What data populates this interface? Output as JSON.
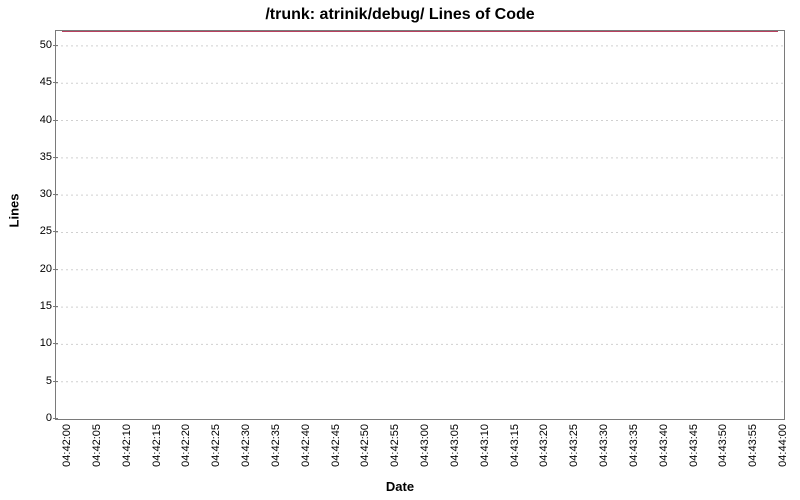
{
  "chart_data": {
    "type": "line",
    "title": "/trunk: atrinik/debug/ Lines of Code",
    "xlabel": "Date",
    "ylabel": "Lines",
    "ylim": [
      0,
      52
    ],
    "y_ticks": [
      0,
      5,
      10,
      15,
      20,
      25,
      30,
      35,
      40,
      45,
      50
    ],
    "x_ticks": [
      "04:42:00",
      "04:42:05",
      "04:42:10",
      "04:42:15",
      "04:42:20",
      "04:42:25",
      "04:42:30",
      "04:42:35",
      "04:42:40",
      "04:42:45",
      "04:42:50",
      "04:42:55",
      "04:43:00",
      "04:43:05",
      "04:43:10",
      "04:43:15",
      "04:43:20",
      "04:43:25",
      "04:43:30",
      "04:43:35",
      "04:43:40",
      "04:43:45",
      "04:43:50",
      "04:43:55",
      "04:44:00"
    ],
    "series": [
      {
        "name": "Lines of Code",
        "color": "#a0002a",
        "x": [
          "04:42:00",
          "04:42:05",
          "04:42:10",
          "04:42:15",
          "04:42:20",
          "04:42:25",
          "04:42:30",
          "04:42:35",
          "04:42:40",
          "04:42:45",
          "04:42:50",
          "04:42:55",
          "04:43:00",
          "04:43:05",
          "04:43:10",
          "04:43:15",
          "04:43:20",
          "04:43:25",
          "04:43:30",
          "04:43:35",
          "04:43:40",
          "04:43:45",
          "04:43:50",
          "04:43:55",
          "04:44:00"
        ],
        "y": [
          52,
          52,
          52,
          52,
          52,
          52,
          52,
          52,
          52,
          52,
          52,
          52,
          52,
          52,
          52,
          52,
          52,
          52,
          52,
          52,
          52,
          52,
          52,
          52,
          52
        ]
      }
    ]
  }
}
